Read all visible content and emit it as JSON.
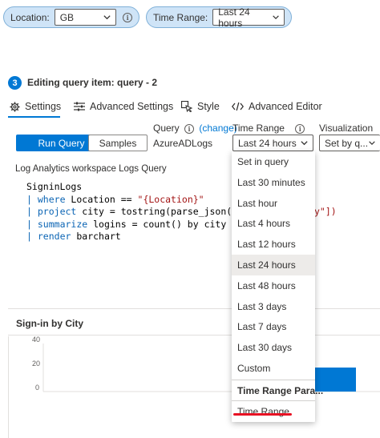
{
  "params": {
    "location": {
      "label": "Location:",
      "value": "GB"
    },
    "time_range": {
      "label": "Time Range:",
      "value": "Last 24 hours"
    }
  },
  "editor": {
    "step": "3",
    "title": "Editing query item: query - 2",
    "tabs": [
      "Settings",
      "Advanced Settings",
      "Style",
      "Advanced Editor"
    ],
    "run_query": "Run Query",
    "samples": "Samples",
    "query_label": "Query",
    "change_link": "(change)",
    "query_source": "AzureADLogs",
    "time_range_label": "Time Range",
    "time_range_value": "Last 24 hours",
    "visualization_label": "Visualization",
    "visualization_value": "Set by q...",
    "workspace_label": "Log Analytics workspace Logs Query",
    "code": {
      "l1": "SigninLogs",
      "l2_kw": "where",
      "l2_rest": " Location == ",
      "l2_str": "\"{Location}\"",
      "l3_kw": "project",
      "l3_rest": " city = tostring(parse_json(Locat",
      "l3_tail": "y\"])",
      "l4_kw": "summarize",
      "l4_rest": " logins = count() by city",
      "l5_kw": "render",
      "l5_rest": " barchart"
    }
  },
  "menu": {
    "items": [
      "Set in query",
      "Last 30 minutes",
      "Last hour",
      "Last 4 hours",
      "Last 12 hours",
      "Last 24 hours",
      "Last 48 hours",
      "Last 3 days",
      "Last 7 days",
      "Last 30 days",
      "Custom"
    ],
    "selected": "Last 24 hours",
    "param_header": "Time Range Para...",
    "param_item": "Time Range"
  },
  "chart_data": {
    "type": "bar",
    "title": "Sign-in by City",
    "categories": [
      ""
    ],
    "values": [
      20
    ],
    "ylim": [
      0,
      40
    ],
    "yticks": [
      "40",
      "20",
      "0"
    ],
    "bar_color": "#0078d4"
  },
  "colors": {
    "accent": "#0078d4",
    "pill_bg": "#cfe4f7",
    "highlight": "#e81123"
  }
}
